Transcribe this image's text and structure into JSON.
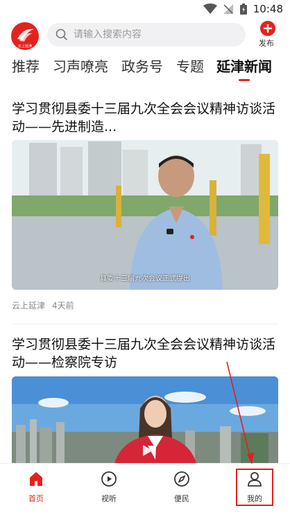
{
  "status": {
    "time": "10:48"
  },
  "header": {
    "logo_text": "云上延津",
    "search_placeholder": "请输入搜索内容",
    "publish_label": "发布"
  },
  "tabs": [
    {
      "label": "推荐",
      "active": false
    },
    {
      "label": "习声嘹亮",
      "active": false
    },
    {
      "label": "政务号",
      "active": false
    },
    {
      "label": "专题",
      "active": false
    },
    {
      "label": "延津新闻",
      "active": true
    }
  ],
  "articles": [
    {
      "title": "学习贯彻县委十三届九次全会会议精神访谈活动——先进制造...",
      "video_caption": "县委十三届九次会议正式提出",
      "source": "云上延津",
      "time": "4天前"
    },
    {
      "title": "学习贯彻县委十三届九次全会会议精神访谈活动——检察院专访"
    }
  ],
  "tabbar": [
    {
      "label": "首页",
      "icon": "home-icon",
      "active": true
    },
    {
      "label": "视听",
      "icon": "play-circle-icon",
      "active": false
    },
    {
      "label": "便民",
      "icon": "compass-icon",
      "active": false
    },
    {
      "label": "我的",
      "icon": "user-icon",
      "active": false
    }
  ],
  "colors": {
    "accent": "#e4221c",
    "annotation": "#e02020"
  }
}
